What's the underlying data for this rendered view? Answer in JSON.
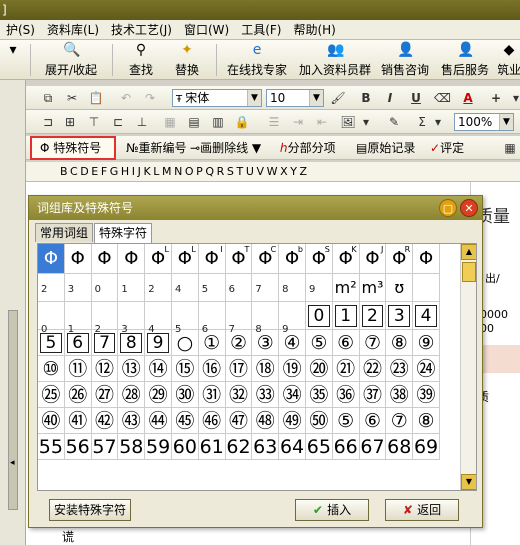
{
  "app": {
    "title_fragment": "]"
  },
  "menu": {
    "items": [
      "护(S)",
      "资料库(L)",
      "技术工艺(J)",
      "窗口(W)",
      "工具(F)",
      "帮助(H)"
    ]
  },
  "big_toolbar": {
    "expand_collapse": "展开/收起",
    "find": "查找",
    "replace": "替换",
    "online_expert": "在线找专家",
    "join_group": "加入资料员群",
    "sales_consult": "销售咨询",
    "after_sales": "售后服务",
    "more": "筑业"
  },
  "format_toolbar": {
    "font_name": "宋体",
    "font_size": "10",
    "zoom": "100%"
  },
  "para_toolbar": {
    "special_symbol": "特殊符号",
    "renumber": "重新编号",
    "strikethrough": "画删除线",
    "sub_items": "分部分项",
    "original_record": "原始记录",
    "evaluate": "评定"
  },
  "letter_ruler": "BCDEFGHIJKLMNOPQRSTUVWXYZ",
  "document": {
    "title_fragment": "质量",
    "cell_fragment": "出/",
    "num_a": "00000",
    "num_b": "000",
    "side_char": "质",
    "bottom_char": "谎"
  },
  "dialog": {
    "title": "词组库及特殊符号",
    "tabs": [
      "常用词组",
      "特殊字符"
    ],
    "row1_symbols": [
      "Φ",
      "Φ",
      "Φ",
      "Φ",
      "Φ",
      "Φ",
      "Φ",
      "Φ",
      "Φ",
      "Φ",
      "Φ",
      "Φ",
      "Φ",
      "Φ",
      "Φ"
    ],
    "row1_sups": [
      "",
      "",
      "",
      "",
      "L",
      "L",
      "I",
      "T",
      "C",
      "b",
      "S",
      "K",
      "J",
      "R",
      ""
    ],
    "row1_subs": [
      "2",
      "3",
      "0",
      "1",
      "2",
      "4",
      "5",
      "6",
      "7",
      "8",
      "9",
      "",
      "",
      "",
      ""
    ],
    "row2_symbols": [
      "",
      "",
      "",
      "",
      "",
      "",
      "",
      "",
      "",
      "",
      "",
      "m²",
      "m³",
      "ʊ",
      ""
    ],
    "row2_subs": [
      "0",
      "1",
      "2",
      "3",
      "4",
      "5",
      "6",
      "7",
      "8",
      "9",
      "",
      "",
      "",
      "",
      ""
    ],
    "row2_boxed": [
      "",
      "",
      "",
      "",
      "",
      "",
      "",
      "",
      "",
      "",
      "0",
      "1",
      "2",
      "3",
      "4"
    ],
    "rows": [
      [
        "5",
        "6",
        "7",
        "8",
        "9",
        "○",
        "①",
        "②",
        "③",
        "④",
        "⑤",
        "⑥",
        "⑦",
        "⑧",
        "⑨"
      ],
      [
        "⑩",
        "⑪",
        "⑫",
        "⑬",
        "⑭",
        "⑮",
        "⑯",
        "⑰",
        "⑱",
        "⑲",
        "⑳",
        "㉑",
        "㉒",
        "㉓",
        "㉔"
      ],
      [
        "㉕",
        "㉖",
        "㉗",
        "㉘",
        "㉙",
        "㉚",
        "㉛",
        "㉜",
        "㉝",
        "㉞",
        "㉟",
        "㊱",
        "㊲",
        "㊳",
        "㊴"
      ],
      [
        "㊵",
        "㊶",
        "㊷",
        "㊸",
        "㊹",
        "㊺",
        "㊻",
        "㊼",
        "㊽",
        "㊾",
        "㊿",
        "⑤",
        "⑥",
        "⑦",
        "⑧"
      ],
      [
        "55",
        "56",
        "57",
        "58",
        "59",
        "60",
        "61",
        "62",
        "63",
        "64",
        "65",
        "66",
        "67",
        "68",
        "69"
      ]
    ],
    "install_button": "安装特殊字符",
    "insert_button": "插入",
    "return_button": "返回"
  }
}
